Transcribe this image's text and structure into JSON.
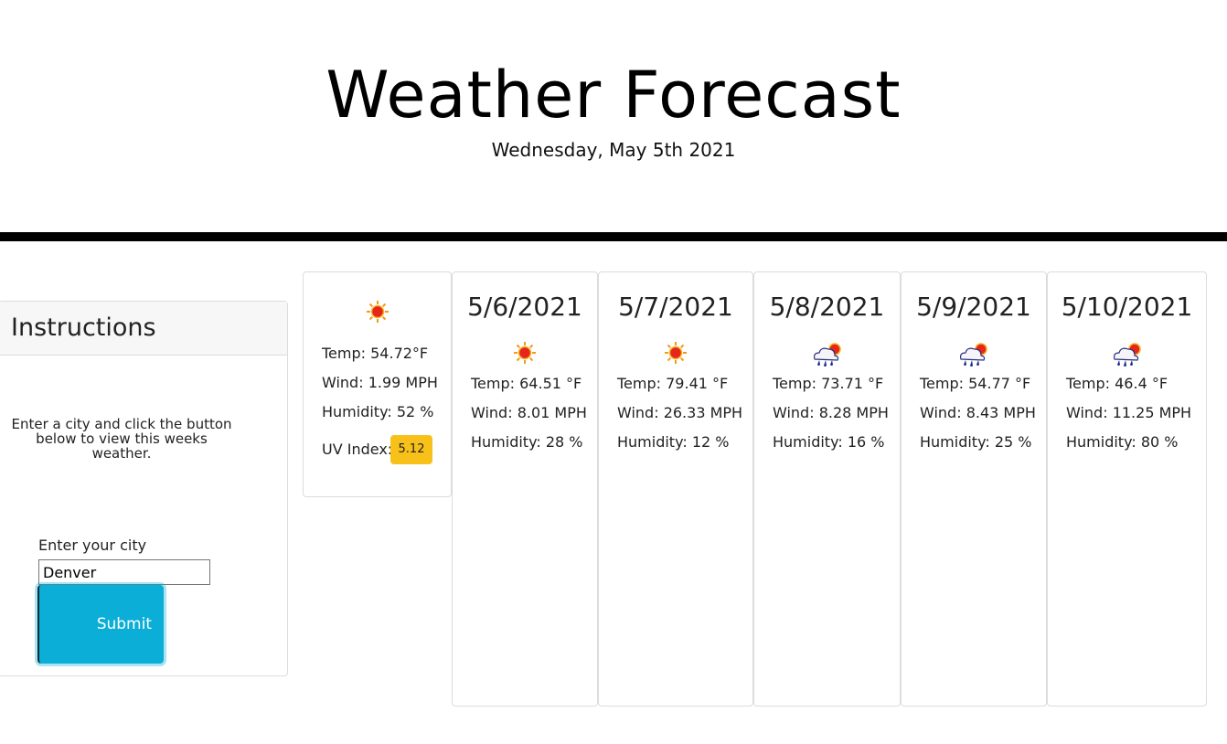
{
  "header": {
    "title": "Weather Forecast",
    "date": "Wednesday, May 5th 2021"
  },
  "instructions": {
    "heading": "Instructions",
    "text": "Enter a city and click the button below to view this weeks weather.",
    "city_label": "Enter your city",
    "city_value": "Denver",
    "submit_label": "Submit"
  },
  "current": {
    "icon": "sun-icon",
    "temp": "Temp: 54.72°F",
    "wind": "Wind: 1.99 MPH",
    "humidity": "Humidity: 52 %",
    "uv_label": "UV Index:",
    "uv_value": "5.12",
    "uv_color": "#f7c11a"
  },
  "forecast": [
    {
      "date": "5/6/2021",
      "icon": "sun-icon",
      "temp": "Temp: 64.51 °F",
      "wind": "Wind: 8.01 MPH",
      "humidity": "Humidity: 28 %"
    },
    {
      "date": "5/7/2021",
      "icon": "sun-icon",
      "temp": "Temp: 79.41 °F",
      "wind": "Wind: 26.33 MPH",
      "humidity": "Humidity: 12 %"
    },
    {
      "date": "5/8/2021",
      "icon": "rain-cloud-sun-icon",
      "temp": "Temp: 73.71 °F",
      "wind": "Wind: 8.28 MPH",
      "humidity": "Humidity: 16 %"
    },
    {
      "date": "5/9/2021",
      "icon": "rain-cloud-sun-icon",
      "temp": "Temp: 54.77 °F",
      "wind": "Wind: 8.43 MPH",
      "humidity": "Humidity: 25 %"
    },
    {
      "date": "5/10/2021",
      "icon": "rain-cloud-sun-icon",
      "temp": "Temp: 46.4 °F",
      "wind": "Wind: 11.25 MPH",
      "humidity": "Humidity: 80 %"
    }
  ],
  "colors": {
    "accent": "#0baed6",
    "divider": "#000000"
  }
}
